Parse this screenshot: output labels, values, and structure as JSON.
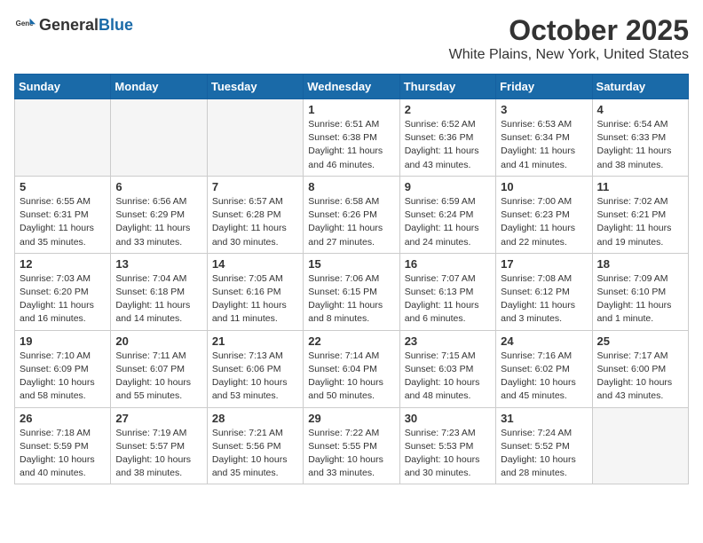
{
  "header": {
    "logo_general": "General",
    "logo_blue": "Blue",
    "month": "October 2025",
    "location": "White Plains, New York, United States"
  },
  "weekdays": [
    "Sunday",
    "Monday",
    "Tuesday",
    "Wednesday",
    "Thursday",
    "Friday",
    "Saturday"
  ],
  "weeks": [
    [
      {
        "day": "",
        "info": ""
      },
      {
        "day": "",
        "info": ""
      },
      {
        "day": "",
        "info": ""
      },
      {
        "day": "1",
        "info": "Sunrise: 6:51 AM\nSunset: 6:38 PM\nDaylight: 11 hours\nand 46 minutes."
      },
      {
        "day": "2",
        "info": "Sunrise: 6:52 AM\nSunset: 6:36 PM\nDaylight: 11 hours\nand 43 minutes."
      },
      {
        "day": "3",
        "info": "Sunrise: 6:53 AM\nSunset: 6:34 PM\nDaylight: 11 hours\nand 41 minutes."
      },
      {
        "day": "4",
        "info": "Sunrise: 6:54 AM\nSunset: 6:33 PM\nDaylight: 11 hours\nand 38 minutes."
      }
    ],
    [
      {
        "day": "5",
        "info": "Sunrise: 6:55 AM\nSunset: 6:31 PM\nDaylight: 11 hours\nand 35 minutes."
      },
      {
        "day": "6",
        "info": "Sunrise: 6:56 AM\nSunset: 6:29 PM\nDaylight: 11 hours\nand 33 minutes."
      },
      {
        "day": "7",
        "info": "Sunrise: 6:57 AM\nSunset: 6:28 PM\nDaylight: 11 hours\nand 30 minutes."
      },
      {
        "day": "8",
        "info": "Sunrise: 6:58 AM\nSunset: 6:26 PM\nDaylight: 11 hours\nand 27 minutes."
      },
      {
        "day": "9",
        "info": "Sunrise: 6:59 AM\nSunset: 6:24 PM\nDaylight: 11 hours\nand 24 minutes."
      },
      {
        "day": "10",
        "info": "Sunrise: 7:00 AM\nSunset: 6:23 PM\nDaylight: 11 hours\nand 22 minutes."
      },
      {
        "day": "11",
        "info": "Sunrise: 7:02 AM\nSunset: 6:21 PM\nDaylight: 11 hours\nand 19 minutes."
      }
    ],
    [
      {
        "day": "12",
        "info": "Sunrise: 7:03 AM\nSunset: 6:20 PM\nDaylight: 11 hours\nand 16 minutes."
      },
      {
        "day": "13",
        "info": "Sunrise: 7:04 AM\nSunset: 6:18 PM\nDaylight: 11 hours\nand 14 minutes."
      },
      {
        "day": "14",
        "info": "Sunrise: 7:05 AM\nSunset: 6:16 PM\nDaylight: 11 hours\nand 11 minutes."
      },
      {
        "day": "15",
        "info": "Sunrise: 7:06 AM\nSunset: 6:15 PM\nDaylight: 11 hours\nand 8 minutes."
      },
      {
        "day": "16",
        "info": "Sunrise: 7:07 AM\nSunset: 6:13 PM\nDaylight: 11 hours\nand 6 minutes."
      },
      {
        "day": "17",
        "info": "Sunrise: 7:08 AM\nSunset: 6:12 PM\nDaylight: 11 hours\nand 3 minutes."
      },
      {
        "day": "18",
        "info": "Sunrise: 7:09 AM\nSunset: 6:10 PM\nDaylight: 11 hours\nand 1 minute."
      }
    ],
    [
      {
        "day": "19",
        "info": "Sunrise: 7:10 AM\nSunset: 6:09 PM\nDaylight: 10 hours\nand 58 minutes."
      },
      {
        "day": "20",
        "info": "Sunrise: 7:11 AM\nSunset: 6:07 PM\nDaylight: 10 hours\nand 55 minutes."
      },
      {
        "day": "21",
        "info": "Sunrise: 7:13 AM\nSunset: 6:06 PM\nDaylight: 10 hours\nand 53 minutes."
      },
      {
        "day": "22",
        "info": "Sunrise: 7:14 AM\nSunset: 6:04 PM\nDaylight: 10 hours\nand 50 minutes."
      },
      {
        "day": "23",
        "info": "Sunrise: 7:15 AM\nSunset: 6:03 PM\nDaylight: 10 hours\nand 48 minutes."
      },
      {
        "day": "24",
        "info": "Sunrise: 7:16 AM\nSunset: 6:02 PM\nDaylight: 10 hours\nand 45 minutes."
      },
      {
        "day": "25",
        "info": "Sunrise: 7:17 AM\nSunset: 6:00 PM\nDaylight: 10 hours\nand 43 minutes."
      }
    ],
    [
      {
        "day": "26",
        "info": "Sunrise: 7:18 AM\nSunset: 5:59 PM\nDaylight: 10 hours\nand 40 minutes."
      },
      {
        "day": "27",
        "info": "Sunrise: 7:19 AM\nSunset: 5:57 PM\nDaylight: 10 hours\nand 38 minutes."
      },
      {
        "day": "28",
        "info": "Sunrise: 7:21 AM\nSunset: 5:56 PM\nDaylight: 10 hours\nand 35 minutes."
      },
      {
        "day": "29",
        "info": "Sunrise: 7:22 AM\nSunset: 5:55 PM\nDaylight: 10 hours\nand 33 minutes."
      },
      {
        "day": "30",
        "info": "Sunrise: 7:23 AM\nSunset: 5:53 PM\nDaylight: 10 hours\nand 30 minutes."
      },
      {
        "day": "31",
        "info": "Sunrise: 7:24 AM\nSunset: 5:52 PM\nDaylight: 10 hours\nand 28 minutes."
      },
      {
        "day": "",
        "info": ""
      }
    ]
  ]
}
